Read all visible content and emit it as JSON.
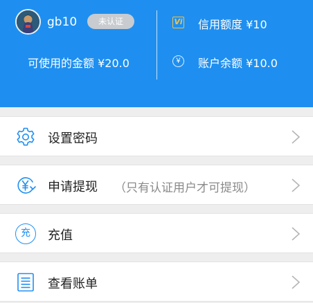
{
  "account": {
    "username": "gb10",
    "verification_badge": "未认证",
    "available_amount": "可使用的金额 ¥20.0",
    "credit_icon_glyph": "Vi",
    "credit_limit": "信用额度 ¥10",
    "balance_icon_glyph": "￥",
    "account_balance": "账户余额 ¥10.0"
  },
  "menu": {
    "items": [
      {
        "label": "设置密码",
        "note": "",
        "icon": "gear-icon"
      },
      {
        "label": "申请提现",
        "note": "（只有认证用户才可提现）",
        "icon": "withdraw-yen-icon"
      },
      {
        "label": "充值",
        "note": "",
        "icon": "recharge-icon",
        "icon_glyph": "充"
      },
      {
        "label": "查看账单",
        "note": "",
        "icon": "bill-icon"
      }
    ]
  },
  "colors": {
    "header_bg": "#1e8ff0",
    "icon_blue": "#1e8ff0",
    "credit_gold": "#f0c24a",
    "badge_gray": "#c8cbd0"
  }
}
